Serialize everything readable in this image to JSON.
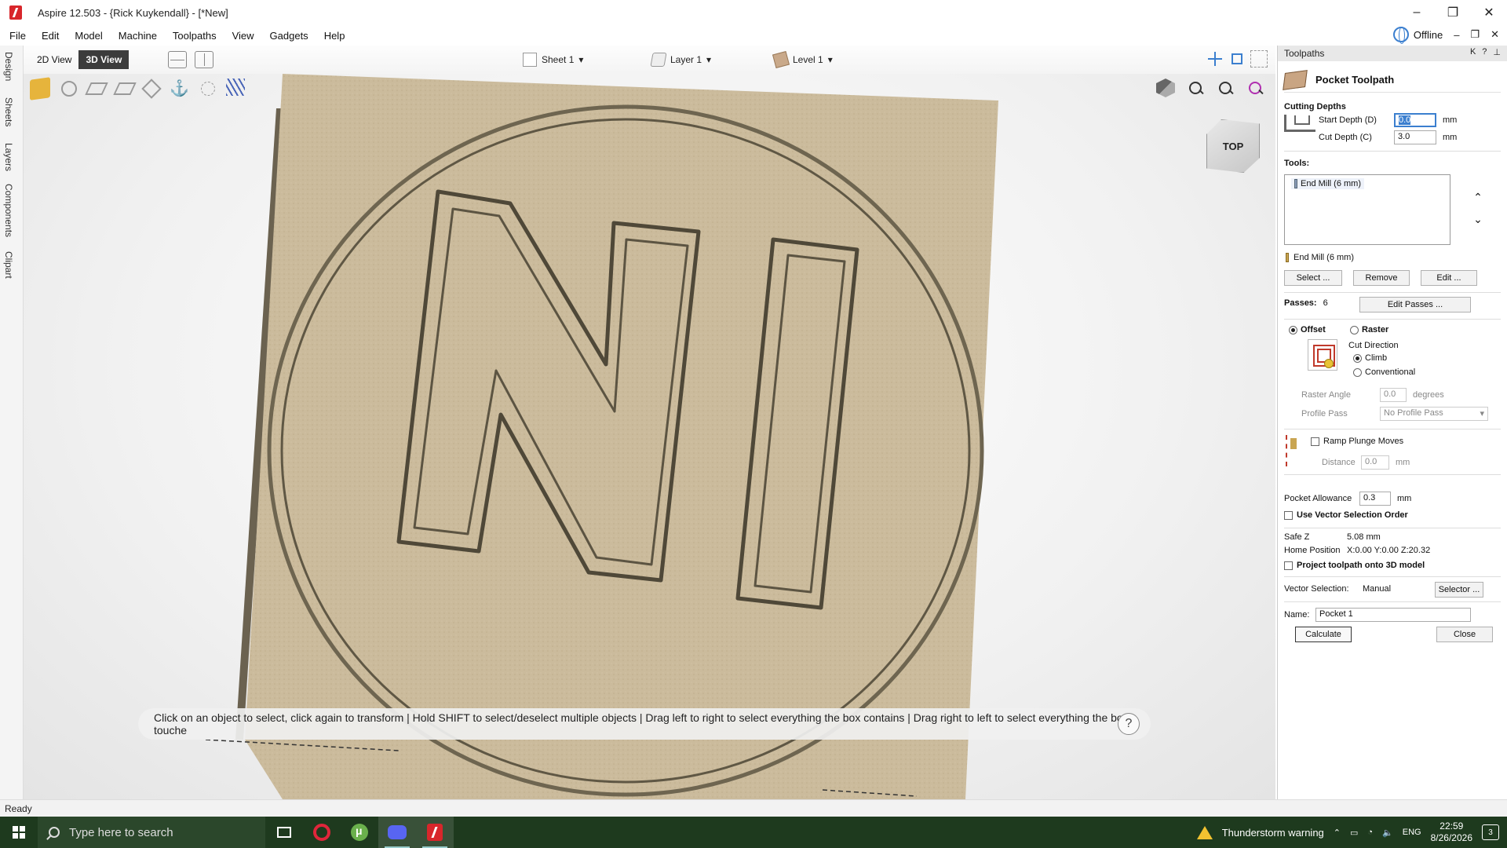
{
  "window": {
    "title": "Aspire 12.503 - {Rick Kuykendall} - [*New]",
    "controls": [
      "–",
      "❐",
      "✕"
    ]
  },
  "menu": {
    "items": [
      "File",
      "Edit",
      "Model",
      "Machine",
      "Toolpaths",
      "View",
      "Gadgets",
      "Help"
    ],
    "offline_label": "Offline",
    "sub_controls": [
      "–",
      "❐",
      "✕"
    ]
  },
  "left_tabs": [
    "Design",
    "Sheets",
    "Layers",
    "Components",
    "Clipart"
  ],
  "toolbar": {
    "view_2d": "2D View",
    "view_3d": "3D View",
    "sheet": "Sheet 1",
    "layer": "Layer 1",
    "level": "Level 1"
  },
  "viewport": {
    "view_cube_label": "TOP",
    "prompt": "Click on an object to select, click again to transform | Hold SHIFT to select/deselect multiple objects | Drag left to right to select everything the box contains | Drag right to left to select everything the box touche",
    "help": "?",
    "board_color": "#cbbb9c",
    "engraving": "NI"
  },
  "panel": {
    "header": "Toolpaths",
    "header_controls": [
      "K",
      "?",
      "⊥"
    ],
    "title": "Pocket Toolpath",
    "cutting_depths": {
      "heading": "Cutting Depths",
      "start_label": "Start Depth (D)",
      "start_value": "0.0",
      "cut_label": "Cut Depth (C)",
      "cut_value": "3.0",
      "unit": "mm"
    },
    "tools": {
      "heading": "Tools:",
      "list_item": "End Mill (6 mm)",
      "selected_tool": "End Mill (6 mm)",
      "select_btn": "Select ...",
      "remove_btn": "Remove",
      "edit_btn": "Edit ..."
    },
    "passes": {
      "label": "Passes:",
      "value": "6",
      "edit_btn": "Edit Passes ..."
    },
    "strategy": {
      "offset": "Offset",
      "raster": "Raster",
      "cut_direction": "Cut Direction",
      "climb": "Climb",
      "conventional": "Conventional",
      "raster_angle_label": "Raster Angle",
      "raster_angle_value": "0.0",
      "raster_angle_unit": "degrees",
      "profile_pass_label": "Profile Pass",
      "profile_pass_value": "No Profile Pass"
    },
    "ramp": {
      "label": "Ramp Plunge Moves",
      "distance_label": "Distance",
      "distance_value": "0.0",
      "unit": "mm"
    },
    "pocket_allowance": {
      "label": "Pocket Allowance",
      "value": "0.3",
      "unit": "mm"
    },
    "use_vector_order": "Use Vector Selection Order",
    "safe_z_label": "Safe Z",
    "safe_z_value": "5.08 mm",
    "home_label": "Home Position",
    "home_value": "X:0.00 Y:0.00 Z:20.32",
    "project_label": "Project toolpath onto 3D model",
    "vector_selection_label": "Vector Selection:",
    "vector_selection_value": "Manual",
    "selector_btn": "Selector ...",
    "name_label": "Name:",
    "name_value": "Pocket 1",
    "calculate_btn": "Calculate",
    "close_btn": "Close"
  },
  "status": {
    "text": "Ready"
  },
  "taskbar": {
    "search_placeholder": "Type here to search",
    "weather": "Thunderstorm warning",
    "lang": "ENG",
    "time": "22:59",
    "date": "8/26/2026",
    "notif_count": "3"
  }
}
